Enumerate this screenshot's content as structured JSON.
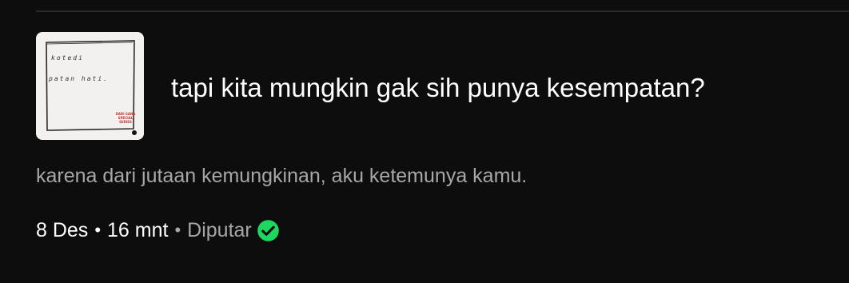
{
  "episode": {
    "cover": {
      "line1": "kotedi",
      "line2": "patan hati.",
      "stamp": "DARI SANA SPECIAL SERIES"
    },
    "title": "tapi kita mungkin gak sih punya kesempatan?",
    "description": "karena dari jutaan kemungkinan, aku ketemunya kamu.",
    "meta": {
      "date": "8 Des",
      "separator": "•",
      "duration": "16 mnt",
      "status": "Diputar",
      "status_icon": "check-circle-icon",
      "status_color": "#1ed760"
    }
  }
}
